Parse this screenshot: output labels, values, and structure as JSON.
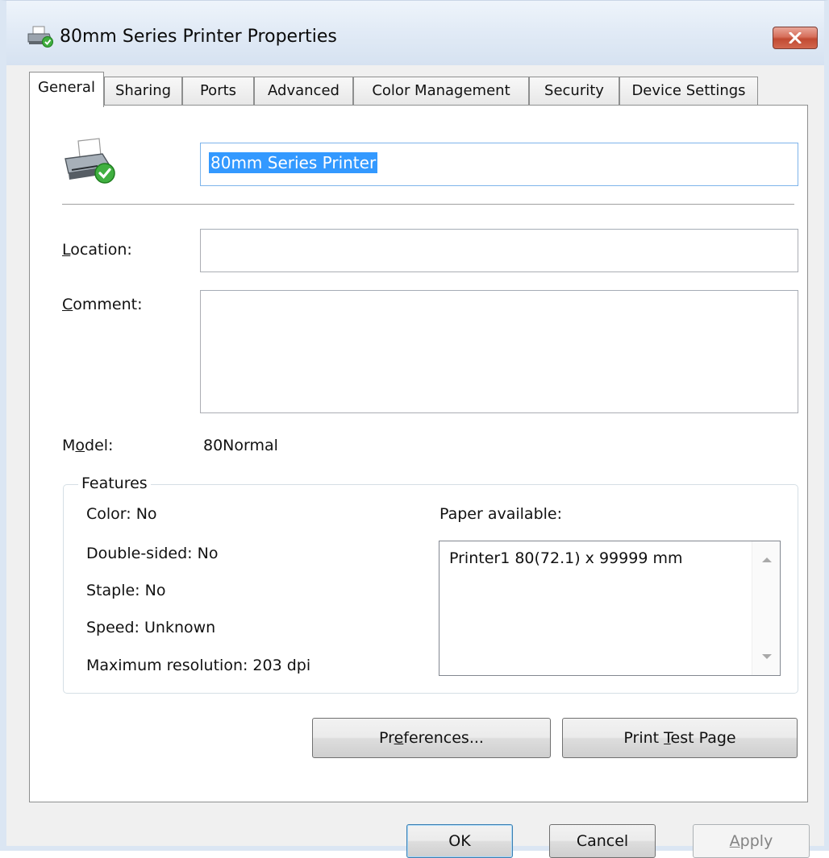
{
  "window": {
    "title": "80mm Series Printer Properties",
    "close_glyph": "✕",
    "accent_color": "#c14a32"
  },
  "tabs": [
    {
      "label": "General",
      "active": true
    },
    {
      "label": "Sharing",
      "active": false
    },
    {
      "label": "Ports",
      "active": false
    },
    {
      "label": "Advanced",
      "active": false
    },
    {
      "label": "Color Management",
      "active": false
    },
    {
      "label": "Security",
      "active": false
    },
    {
      "label": "Device Settings",
      "active": false
    }
  ],
  "general": {
    "printer_icon": "printer-icon",
    "printer_name": "80mm Series Printer",
    "location": {
      "label_pre": "",
      "label_key": "L",
      "label_post": "ocation:",
      "value": ""
    },
    "comment": {
      "label_pre": "",
      "label_key": "C",
      "label_post": "omment:",
      "value": ""
    },
    "model": {
      "label_pre": "M",
      "label_key": "o",
      "label_post": "del:",
      "value": "80Normal"
    }
  },
  "features": {
    "title": "Features",
    "color": "Color: No",
    "double_sided": "Double-sided: No",
    "staple": "Staple: No",
    "speed": "Speed: Unknown",
    "max_resolution": "Maximum resolution: 203 dpi",
    "paper_available_label": "Paper available:",
    "paper_list": [
      "Printer1 80(72.1) x 99999 mm"
    ]
  },
  "buttons": {
    "preferences": {
      "pre": "Pr",
      "key": "e",
      "post": "ferences..."
    },
    "print_test_page": {
      "pre": "Print ",
      "key": "T",
      "post": "est Page"
    },
    "ok": "OK",
    "cancel": "Cancel",
    "apply": {
      "pre": "",
      "key": "A",
      "post": "pply"
    }
  }
}
